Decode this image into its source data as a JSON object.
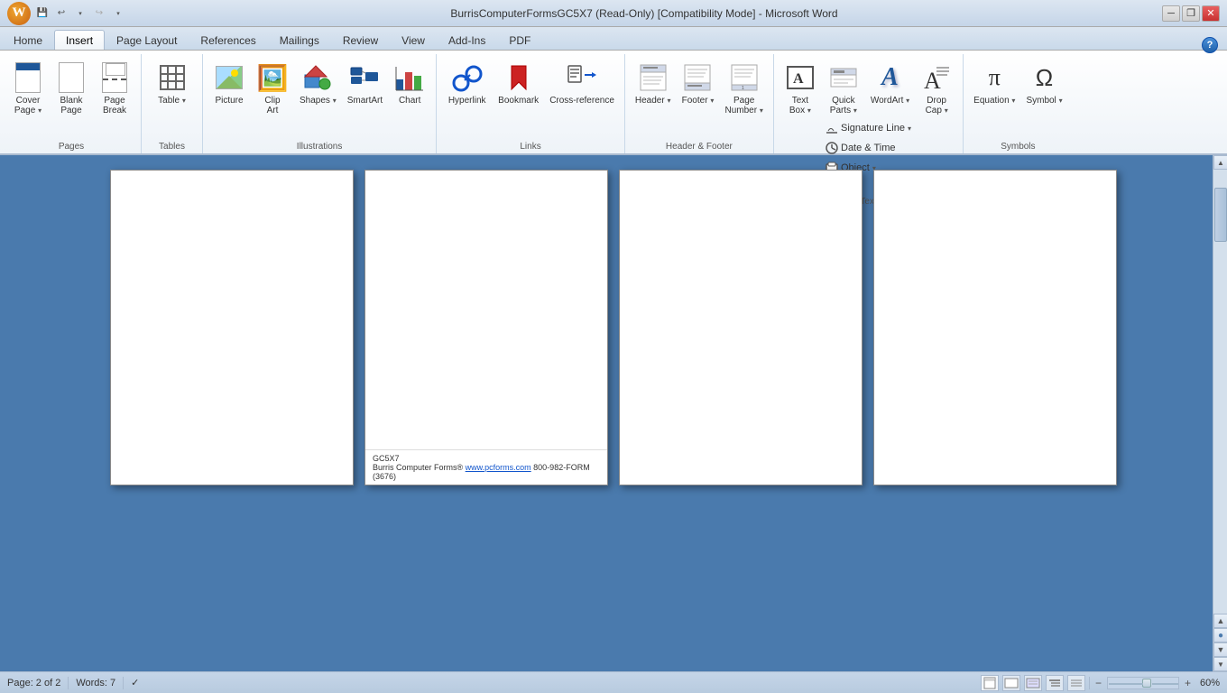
{
  "title_bar": {
    "title": "BurrisComputerFormsGC5X7 (Read-Only) [Compatibility Mode] - Microsoft Word",
    "minimize": "─",
    "restore": "❐",
    "close": "✕"
  },
  "quick_access": {
    "save": "💾",
    "undo": "↩",
    "undo_arrow": "▾",
    "redo": "↪",
    "customize": "▾"
  },
  "tabs": [
    {
      "id": "home",
      "label": "Home",
      "active": false
    },
    {
      "id": "insert",
      "label": "Insert",
      "active": true
    },
    {
      "id": "page_layout",
      "label": "Page Layout",
      "active": false
    },
    {
      "id": "references",
      "label": "References",
      "active": false
    },
    {
      "id": "mailings",
      "label": "Mailings",
      "active": false
    },
    {
      "id": "review",
      "label": "Review",
      "active": false
    },
    {
      "id": "view",
      "label": "View",
      "active": false
    },
    {
      "id": "add_ins",
      "label": "Add-Ins",
      "active": false
    },
    {
      "id": "pdf",
      "label": "PDF",
      "active": false
    }
  ],
  "ribbon": {
    "groups": [
      {
        "id": "pages",
        "label": "Pages",
        "buttons": [
          {
            "id": "cover_page",
            "label": "Cover\nPage",
            "icon": "cover"
          },
          {
            "id": "blank_page",
            "label": "Blank\nPage",
            "icon": "blank"
          },
          {
            "id": "page_break",
            "label": "Page\nBreak",
            "icon": "pagebreak"
          }
        ]
      },
      {
        "id": "tables",
        "label": "Tables",
        "buttons": [
          {
            "id": "table",
            "label": "Table",
            "icon": "table"
          }
        ]
      },
      {
        "id": "illustrations",
        "label": "Illustrations",
        "buttons": [
          {
            "id": "picture",
            "label": "Picture",
            "icon": "picture"
          },
          {
            "id": "clip_art",
            "label": "Clip\nArt",
            "icon": "clipart"
          },
          {
            "id": "shapes",
            "label": "Shapes",
            "icon": "shapes"
          },
          {
            "id": "smart_art",
            "label": "SmartArt",
            "icon": "smartart"
          },
          {
            "id": "chart",
            "label": "Chart",
            "icon": "chart"
          }
        ]
      },
      {
        "id": "links",
        "label": "Links",
        "buttons": [
          {
            "id": "hyperlink",
            "label": "Hyperlink",
            "icon": "hyperlink"
          },
          {
            "id": "bookmark",
            "label": "Bookmark",
            "icon": "bookmark"
          },
          {
            "id": "cross_reference",
            "label": "Cross-reference",
            "icon": "crossref"
          }
        ]
      },
      {
        "id": "header_footer",
        "label": "Header & Footer",
        "buttons": [
          {
            "id": "header",
            "label": "Header",
            "icon": "header"
          },
          {
            "id": "footer",
            "label": "Footer",
            "icon": "footer"
          },
          {
            "id": "page_number",
            "label": "Page\nNumber",
            "icon": "pagenumber"
          }
        ]
      },
      {
        "id": "text",
        "label": "Text",
        "buttons": [
          {
            "id": "text_box",
            "label": "Text\nBox",
            "icon": "textbox"
          },
          {
            "id": "quick_parts",
            "label": "Quick\nParts",
            "icon": "quickparts"
          },
          {
            "id": "word_art",
            "label": "WordArt",
            "icon": "wordart"
          },
          {
            "id": "drop_cap",
            "label": "Drop\nCap",
            "icon": "dropcap"
          }
        ]
      },
      {
        "id": "text_right",
        "label": "",
        "small_buttons": [
          {
            "id": "signature_line",
            "label": "Signature Line",
            "has_arrow": true
          },
          {
            "id": "date_time",
            "label": "Date & Time"
          },
          {
            "id": "object",
            "label": "Object",
            "has_arrow": true
          }
        ]
      },
      {
        "id": "symbols",
        "label": "Symbols",
        "buttons": [
          {
            "id": "equation",
            "label": "Equation",
            "icon": "equation"
          },
          {
            "id": "symbol",
            "label": "Symbol",
            "icon": "symbol"
          }
        ]
      }
    ]
  },
  "pages": [
    {
      "id": "page1",
      "has_footer": false,
      "footer_text": ""
    },
    {
      "id": "page2",
      "has_footer": true,
      "footer_line1": "GC5X7",
      "footer_line2_pre": "Burris Computer Forms® ",
      "footer_link": "www.pcforms.com",
      "footer_line2_post": " 800-982-FORM (3676)"
    },
    {
      "id": "page3",
      "has_footer": false,
      "footer_text": ""
    },
    {
      "id": "page4",
      "has_footer": false,
      "footer_text": ""
    }
  ],
  "status_bar": {
    "page_info": "Page: 2 of 2",
    "word_count": "Words: 7",
    "zoom_level": "60%"
  }
}
